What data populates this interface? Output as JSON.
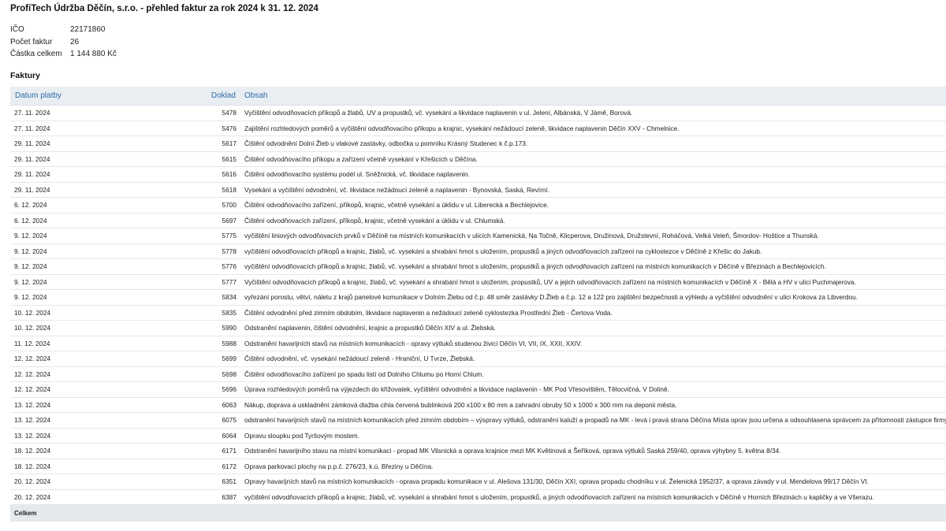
{
  "header": {
    "title": "ProfiTech Údržba Děčín, s.r.o. - přehled faktur za rok 2024 k 31. 12. 2024"
  },
  "summary": {
    "ico_label": "IČO",
    "ico_value": "22171860",
    "count_label": "Počet faktur",
    "count_value": "26",
    "amount_label": "Částka celkem",
    "amount_value": "1 144 880 Kč"
  },
  "invoices": {
    "section_title": "Faktury",
    "columns": {
      "date": "Datum platby",
      "doklad": "Doklad",
      "obsah": "Obsah"
    },
    "rows": [
      {
        "date": "27. 11. 2024",
        "doklad": "5478",
        "obsah": "Vyčištění odvodňovacích příkopů a žlabů, UV a propustků, vč. vysekání a likvidace naplavenin v ul. Jelení, Albánská, V Jámě, Borová."
      },
      {
        "date": "27. 11. 2024",
        "doklad": "5476",
        "obsah": "Zajištění rozhledových poměrů a vyčištění odvodňovacího příkopu a krajnic, vysekání nežádoucí zeleně, likvidace naplavenin Děčín XXV - Chmelnice."
      },
      {
        "date": "29. 11. 2024",
        "doklad": "5617",
        "obsah": "Čištění odvodnění Dolní Žleb u vlakové zastávky, odbočka u pomníku Krásný Studenec k č.p.173."
      },
      {
        "date": "29. 11. 2024",
        "doklad": "5615",
        "obsah": "Čištění odvodňovacího příkopu a zařízení včetně vysekání v Křešicích u Děčína."
      },
      {
        "date": "29. 11. 2024",
        "doklad": "5616",
        "obsah": "Čištění odvodňovacího systému podél ul. Sněžnická, vč. likvidace naplavenin."
      },
      {
        "date": "29. 11. 2024",
        "doklad": "5618",
        "obsah": "Vysekání a vyčištění odvodnění, vč. likvidace nežádoucí zeleně a naplavenin - Bynovská, Saská, Revírní."
      },
      {
        "date": "6. 12. 2024",
        "doklad": "5700",
        "obsah": "Čištění odvodňovacího zařízení, příkopů, krajnic, včetně vysekání a úklidu v ul. Liberecká a Bechlejovice."
      },
      {
        "date": "6. 12. 2024",
        "doklad": "5697",
        "obsah": "Čištění odvodňovacích zařízení, příkopů, krajnic, včetně vysekání a úklidu v ul. Chlumská."
      },
      {
        "date": "9. 12. 2024",
        "doklad": "5775",
        "obsah": "vyčištění liniových odvodňovacích prvků v Děčíně na místních komunikacích v ulicích Kamenická, Na Točně, Klicperova, Družinová, Družstevní, Roháčová, Velká Veleň, Šmordov- Hoštice a Thunská."
      },
      {
        "date": "9. 12. 2024",
        "doklad": "5778",
        "obsah": "vyčištění odvodňovacích příkopů a krajnic, žlabů, vč. vysekání a shrabání hmot s uložením, propustků a jiných odvodňovacích zařízení na cyklostezce v Děčíně z Křešic do Jakub."
      },
      {
        "date": "9. 12. 2024",
        "doklad": "5776",
        "obsah": "vyčištění odvodňovacích příkopů a krajnic, žlabů, vč. vysekání a shrabání hmot s uložením, propustků a jiných odvodňovacích zařízení na místních komunikacích v Děčíně v Březinách a Bechlejovicích."
      },
      {
        "date": "9. 12. 2024",
        "doklad": "5777",
        "obsah": "Vyčištění odvodňovacích příkopů a krajnic, žlabů, vč. vysekání a shrabání hmot s uložením, propustků, UV a jejich odvodňovacích zařízení na místních komunikacích v Děčíně X - Bělá a HV v ulici Puchmajerova."
      },
      {
        "date": "9. 12. 2024",
        "doklad": "5834",
        "obsah": "vyřezání porostu, větví, náletu z krajů panelové komunikace v Dolním Žlebu od č.p. 48 směr zastávky D.Žleb a č.p. 12 a 122 pro zajištění bezpečnosti a výhledu a vyčištění odvodnění v ulici Krokova za Libverdou."
      },
      {
        "date": "10. 12. 2024",
        "doklad": "5835",
        "obsah": "Čištění odvodnění před zimním obdobím, likvidace naplavenin a nežádoucí zeleně cyklostezka Prostřední Žleb - Čertova Voda."
      },
      {
        "date": "10. 12. 2024",
        "doklad": "5990",
        "obsah": "Odstranění naplavenin, čištění odvodnění, krajnic a propustků Děčín XIV a ul. Žlebská."
      },
      {
        "date": "11. 12. 2024",
        "doklad": "5988",
        "obsah": "Odstranění havarijních stavů na místních komunikacích - opravy výtluků studenou živicí Děčín VI, VII, IX, XXII, XXIV."
      },
      {
        "date": "12. 12. 2024",
        "doklad": "5699",
        "obsah": "Čištění odvodnění, vč. vysekání nežádoucí zeleně - Hraniční, U Tvrze, Žlebská."
      },
      {
        "date": "12. 12. 2024",
        "doklad": "5698",
        "obsah": "Čištění odvodňovacího zařízení po spadu listí od Dolního Chlumu po Horní Chlum."
      },
      {
        "date": "12. 12. 2024",
        "doklad": "5696",
        "obsah": "Úprava rozhledových poměrů na výjezdech do křižovatek, vyčištění odvodnění a likvidace naplavenin - MK Pod Vřesovištěm, Tělocvičná, V Dolině."
      },
      {
        "date": "13. 12. 2024",
        "doklad": "6063",
        "obsah": "Nákup, doprava a uskladnění zámková dlažba cihla červená bublinková 200 x100 x 80 mm a zahradní obruby 50 x 1000 x 300 mm na deponii města."
      },
      {
        "date": "13. 12. 2024",
        "doklad": "6075",
        "obsah": "odstranění havarijních stavů na místních komunikacích před zimním obdobím – výspravy výtluků, odstranění kaluží a propadů na MK - levá i pravá strana Děčína Místa oprav jsou určena a odsouhlasena správcem za přítomnosti zástupce firmy."
      },
      {
        "date": "13. 12. 2024",
        "doklad": "6064",
        "obsah": "Opravu sloupku pod Tyršovým mostem."
      },
      {
        "date": "18. 12. 2024",
        "doklad": "6171",
        "obsah": "Odstranění havarijního stavu na místní komunikaci - propad MK Vilsnická a oprava krajnice mezi MK Květinová a Šeříková, oprava výtluků Saská 259/40, oprava výhybny 5. května 8/34."
      },
      {
        "date": "18. 12. 2024",
        "doklad": "6172",
        "obsah": "Oprava parkovací plochy na p.p.č. 276/23, k.ú. Březiny u Děčína."
      },
      {
        "date": "20. 12. 2024",
        "doklad": "6351",
        "obsah": "Opravy havarijních stavů na místních komunikacích - oprava propadu komunikace v ul. Alešova 131/30, Děčín XXI, oprava propadu chodníku v ul. Želenická 1952/37, a oprava závady v ul. Mendelova 99/17 Děčín VI."
      },
      {
        "date": "20. 12. 2024",
        "doklad": "6387",
        "obsah": "vyčištění odvodňovacích příkopů a krajnic, žlabů, vč. vysekání a shrabání hmot s uložením, propustků, a jiných odvodňovacích zařízení na místních komunikacích v Děčíně v Horních Březinách u kapličky a ve Všerazu."
      }
    ],
    "total_label": "Celkem"
  },
  "colors": {
    "header_bg": "#e9eef3",
    "header_text": "#2e6aa8",
    "total_bg": "#e6e9ec"
  }
}
